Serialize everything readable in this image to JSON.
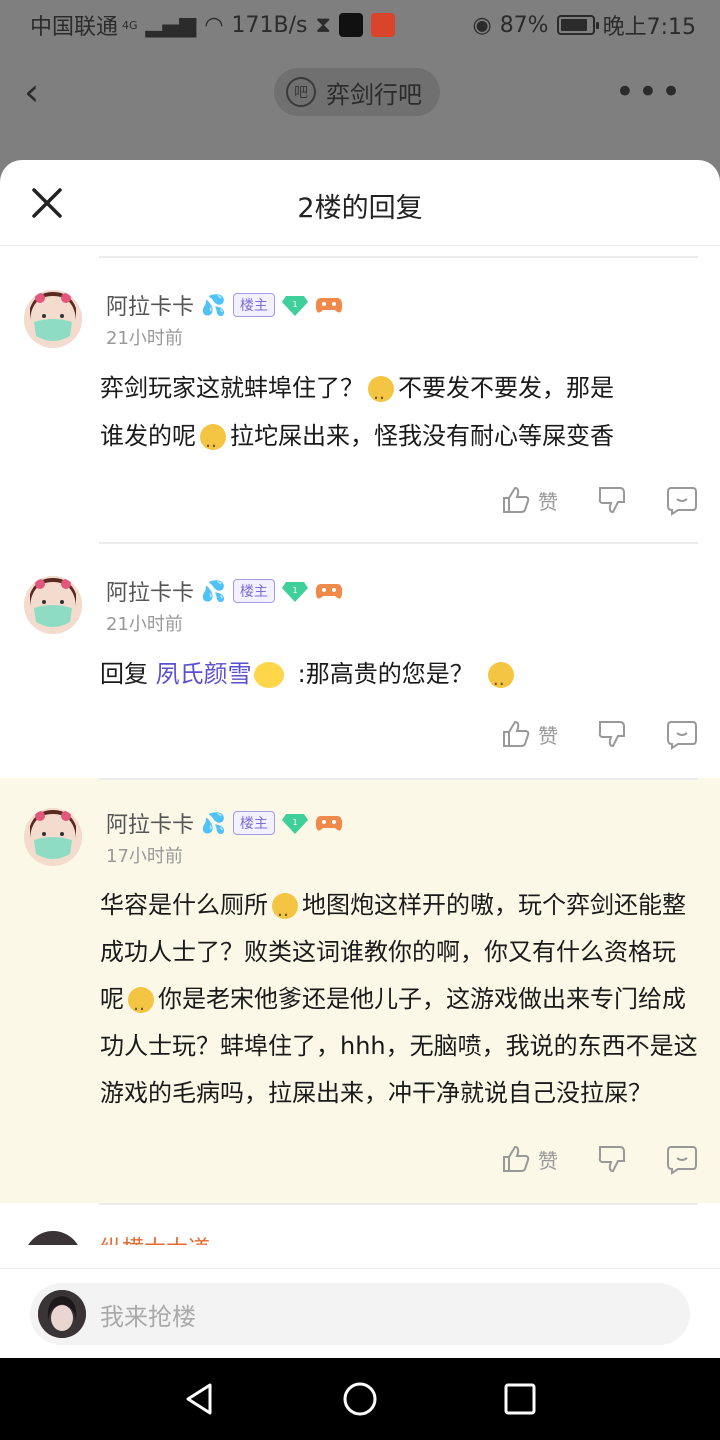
{
  "status": {
    "carrier": "中国联通",
    "network": "4G",
    "speed": "171B/s",
    "battery": "87%",
    "battery_level": 0.87,
    "time": "晚上7:15"
  },
  "topbar": {
    "forum_logo": "吧",
    "forum_name": "弈剑行吧"
  },
  "sheet": {
    "title": "2楼的回复"
  },
  "comments": [
    {
      "user": "阿拉卡卡",
      "badge": "楼主",
      "time": "21小时前",
      "line1_a": "弈剑玩家这就蚌埠住了？",
      "line1_b": "不要发不要发，那是",
      "line2_a": "谁发的呢",
      "line2_b": "拉坨屎出来，怪我没有耐心等屎变香",
      "like_label": "赞"
    },
    {
      "user": "阿拉卡卡",
      "badge": "楼主",
      "time": "21小时前",
      "reply_prefix": "回复",
      "mention": "夙氏颜雪",
      "reply_text": ":那高贵的您是？",
      "like_label": "赞"
    },
    {
      "user": "阿拉卡卡",
      "badge": "楼主",
      "time": "17小时前",
      "p1": "华容是什么厕所",
      "p2": "地图炮这样开的嗷，玩个弈剑还能整成功人士了？败类这词谁教你的啊，你又有什么资格玩呢",
      "p3": "你是老宋他爹还是他儿子，这游戏做出来专门给成功人士玩？蚌埠住了，hhh，无脑喷，我说的东西不是这游戏的毛病吗，拉屎出来，冲干净就说自己没拉屎？",
      "like_label": "赞"
    }
  ],
  "partial_user": "纵横大大道",
  "input": {
    "placeholder": "我来抢楼"
  },
  "colors": {
    "mention": "#5a4fd0",
    "highlight_bg": "#fcf8e8",
    "badge": "#7b6fd6"
  }
}
